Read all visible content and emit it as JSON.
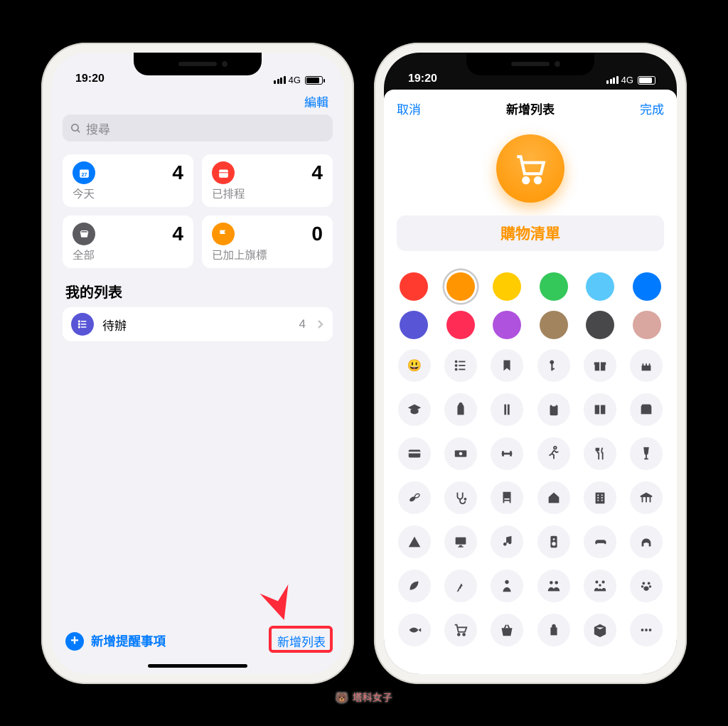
{
  "status": {
    "time": "19:20",
    "net": "4G"
  },
  "screen1": {
    "edit": "編輯",
    "search_placeholder": "搜尋",
    "cards": [
      {
        "label": "今天",
        "count": 4,
        "color": "#007aff",
        "icon": "calendar"
      },
      {
        "label": "已排程",
        "count": 4,
        "color": "#ff3b30",
        "icon": "schedule"
      },
      {
        "label": "全部",
        "count": 4,
        "color": "#5b5b60",
        "icon": "tray"
      },
      {
        "label": "已加上旗標",
        "count": 0,
        "color": "#ff9500",
        "icon": "flag"
      }
    ],
    "section": "我的列表",
    "list": {
      "name": "待辦",
      "count": 4
    },
    "add_reminder": "新增提醒事項",
    "add_list": "新增列表"
  },
  "screen2": {
    "cancel": "取消",
    "title": "新增列表",
    "done": "完成",
    "list_name": "購物清單",
    "accent": "#ff9500",
    "colors_row1": [
      "#ff3b30",
      "#ff9500",
      "#ffcc00",
      "#34c759",
      "#5ac8fa",
      "#007aff"
    ],
    "colors_row2": [
      "#5856d6",
      "#ff2d55",
      "#af52de",
      "#a2845e",
      "#48484a",
      "#d9a6a0"
    ],
    "selected_color_index": 1,
    "icons": [
      "emoji",
      "list",
      "bookmark",
      "key",
      "gift",
      "cake",
      "grad",
      "backpack",
      "ruler",
      "clipboard",
      "book",
      "wallet",
      "card",
      "cash",
      "dumbbell",
      "run",
      "fork",
      "wine",
      "pills",
      "stetho",
      "chair",
      "house",
      "building",
      "museum",
      "tent",
      "monitor",
      "music",
      "speaker",
      "gamepad",
      "headphones",
      "leaf",
      "carrot",
      "person",
      "people",
      "family",
      "paw",
      "fish",
      "cart",
      "basket",
      "bag",
      "box",
      "more"
    ]
  },
  "watermark": "塔科女子"
}
